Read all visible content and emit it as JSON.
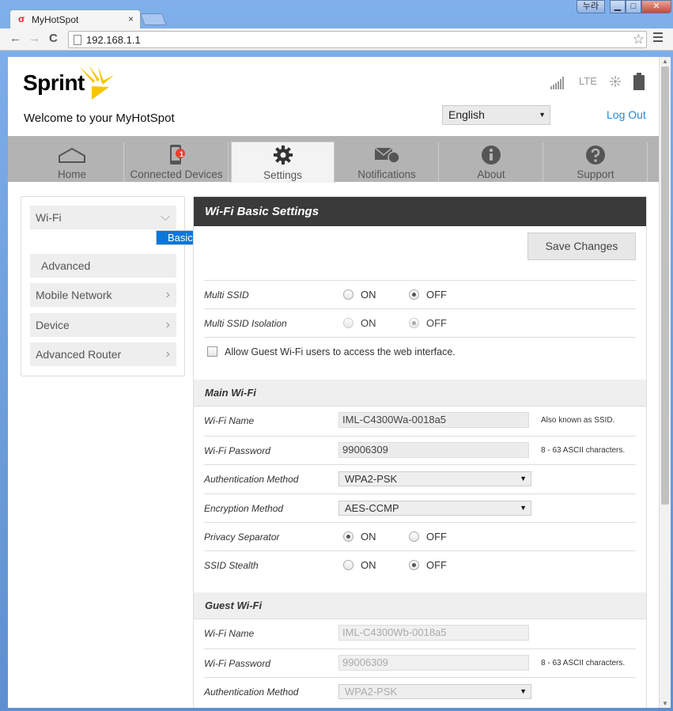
{
  "browser": {
    "tab_title": "MyHotSpot",
    "tab_close": "×",
    "user_button": "누라",
    "min_glyph": "▁",
    "max_glyph": "□",
    "close_glyph": "✕",
    "url": "192.168.1.1",
    "back_glyph": "←",
    "forward_glyph": "→",
    "reload_glyph": "C",
    "star_glyph": "☆"
  },
  "header": {
    "logo": "Sprint",
    "welcome": "Welcome to your MyHotSpot",
    "network": "LTE",
    "language": "English",
    "logout": "Log Out"
  },
  "nav": [
    {
      "label": "Home"
    },
    {
      "label": "Connected Devices",
      "badge": "1"
    },
    {
      "label": "Settings"
    },
    {
      "label": "Notifications"
    },
    {
      "label": "About"
    },
    {
      "label": "Support"
    }
  ],
  "sidebar": {
    "wifi": "Wi-Fi",
    "basic": "Basic",
    "advanced": "Advanced",
    "mobile": "Mobile Network",
    "device": "Device",
    "router": "Advanced Router"
  },
  "main": {
    "title": "Wi-Fi Basic Settings",
    "save": "Save Changes",
    "on": "ON",
    "off": "OFF",
    "multi_ssid": "Multi SSID",
    "multi_ssid_iso": "Multi SSID Isolation",
    "guest_access": "Allow Guest Wi-Fi users to access the web interface.",
    "main_section": "Main Wi-Fi",
    "guest_section": "Guest Wi-Fi",
    "wifi_name": "Wi-Fi Name",
    "wifi_password": "Wi-Fi Password",
    "auth": "Authentication Method",
    "enc": "Encryption Method",
    "privacy": "Privacy Separator",
    "stealth": "SSID Stealth",
    "main_name_val": "IML-C4300Wa-0018a5",
    "main_pw_val": "99006309",
    "auth_val": "WPA2-PSK",
    "enc_val": "AES-CCMP",
    "guest_name_val": "IML-C4300Wb-0018a5",
    "guest_pw_val": "99006309",
    "guest_auth_val": "WPA2-PSK",
    "ssid_hint": "Also known as SSID.",
    "pw_hint": "8 - 63 ASCII characters."
  }
}
